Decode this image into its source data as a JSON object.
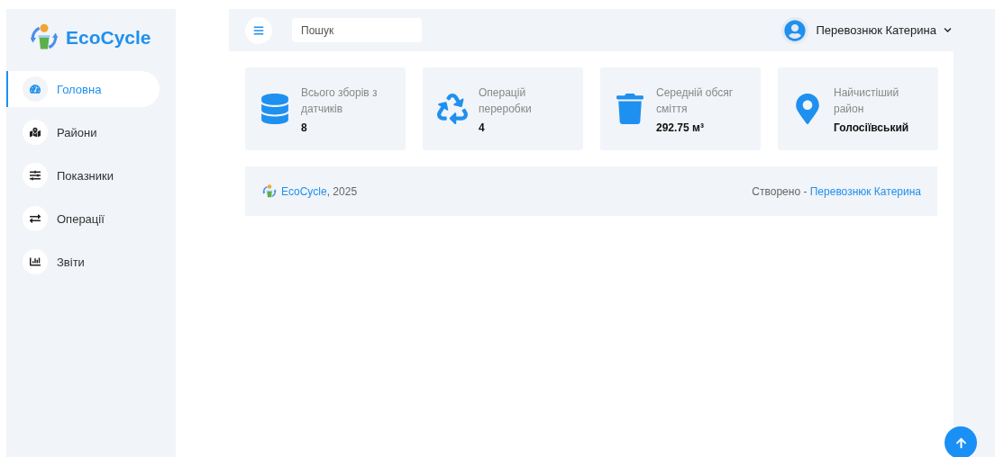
{
  "brand": {
    "name": "EcoCycle"
  },
  "sidebar": {
    "items": [
      {
        "label": "Головна",
        "selected": true
      },
      {
        "label": "Райони",
        "selected": false
      },
      {
        "label": "Показники",
        "selected": false
      },
      {
        "label": "Операції",
        "selected": false
      },
      {
        "label": "Звіти",
        "selected": false
      }
    ]
  },
  "topbar": {
    "search": {
      "placeholder": "Пошук"
    },
    "user": {
      "name": "Перевознюк Катерина"
    }
  },
  "stats": [
    {
      "label": "Всього зборів з датчиків",
      "value": "8"
    },
    {
      "label": "Операцій переробки",
      "value": "4"
    },
    {
      "label": "Середній обсяг сміття",
      "value": "292.75 м³"
    },
    {
      "label": "Найчистіший район",
      "value": "Голосіївський"
    }
  ],
  "footer": {
    "brand": "EcoCycle",
    "year": ", 2025",
    "credit_prefix": "Створено - ",
    "author": "Перевознюк Катерина"
  }
}
